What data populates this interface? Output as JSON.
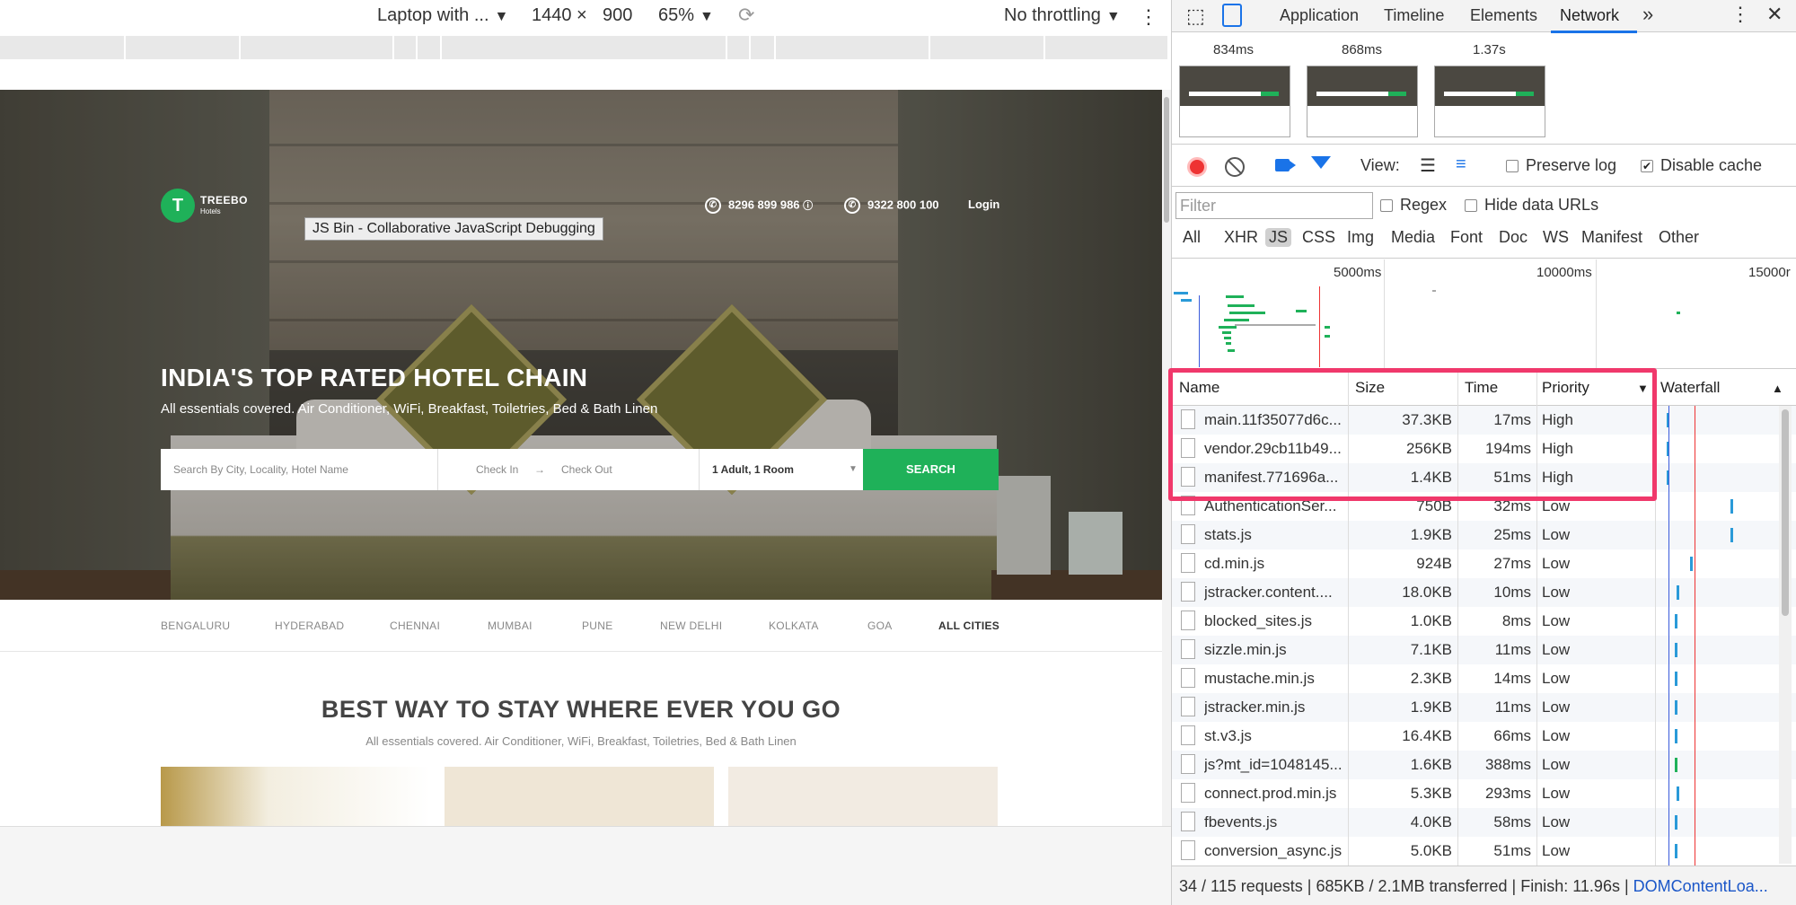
{
  "device_toolbar": {
    "device": "Laptop with ...",
    "width": "1440",
    "times": "×",
    "height": "900",
    "zoom": "65%",
    "throttling": "No throttling"
  },
  "site": {
    "brand": "TREEBO",
    "brand_sub": "Hotels",
    "tooltip": "JS Bin - Collaborative JavaScript Debugging",
    "phone1": "8296 899 986",
    "phone2": "9322 800 100",
    "login": "Login",
    "hero_title": "INDIA'S TOP RATED HOTEL CHAIN",
    "hero_sub": "All essentials covered. Air Conditioner, WiFi, Breakfast, Toiletries, Bed & Bath Linen",
    "search": {
      "placeholder": "Search By City, Locality, Hotel Name",
      "check_in": "Check In",
      "check_out": "Check Out",
      "guests": "1 Adult, 1 Room",
      "button": "SEARCH"
    },
    "cities": [
      "BENGALURU",
      "HYDERABAD",
      "CHENNAI",
      "MUMBAI",
      "PUNE",
      "NEW DELHI",
      "KOLKATA",
      "GOA",
      "ALL CITIES"
    ],
    "section_title": "BEST WAY TO STAY WHERE EVER YOU GO",
    "section_sub": "All essentials covered. Air Conditioner, WiFi, Breakfast, Toiletries, Bed & Bath Linen"
  },
  "devtools": {
    "tabs": [
      "Application",
      "Timeline",
      "Elements",
      "Network"
    ],
    "active_tab": "Network",
    "more": "»",
    "filmstrip": [
      "834ms",
      "868ms",
      "1.37s"
    ],
    "view_label": "View:",
    "preserve_log": "Preserve log",
    "disable_cache": "Disable cache",
    "filter_placeholder": "Filter",
    "regex": "Regex",
    "hide_data_urls": "Hide data URLs",
    "types": [
      "All",
      "XHR",
      "JS",
      "CSS",
      "Img",
      "Media",
      "Font",
      "Doc",
      "WS",
      "Manifest",
      "Other"
    ],
    "active_type": "JS",
    "overview_labels": [
      "5000ms",
      "10000ms",
      "15000r"
    ],
    "columns": [
      "Name",
      "Size",
      "Time",
      "Priority",
      "Waterfall"
    ],
    "sort_indicator": "▼",
    "waterfall_sort": "▲",
    "rows": [
      {
        "name": "main.11f35077d6c...",
        "size": "37.3KB",
        "time": "17ms",
        "priority": "High"
      },
      {
        "name": "vendor.29cb11b49...",
        "size": "256KB",
        "time": "194ms",
        "priority": "High"
      },
      {
        "name": "manifest.771696a...",
        "size": "1.4KB",
        "time": "51ms",
        "priority": "High"
      },
      {
        "name": "AuthenticationSer...",
        "size": "750B",
        "time": "32ms",
        "priority": "Low"
      },
      {
        "name": "stats.js",
        "size": "1.9KB",
        "time": "25ms",
        "priority": "Low"
      },
      {
        "name": "cd.min.js",
        "size": "924B",
        "time": "27ms",
        "priority": "Low"
      },
      {
        "name": "jstracker.content....",
        "size": "18.0KB",
        "time": "10ms",
        "priority": "Low"
      },
      {
        "name": "blocked_sites.js",
        "size": "1.0KB",
        "time": "8ms",
        "priority": "Low"
      },
      {
        "name": "sizzle.min.js",
        "size": "7.1KB",
        "time": "11ms",
        "priority": "Low"
      },
      {
        "name": "mustache.min.js",
        "size": "2.3KB",
        "time": "14ms",
        "priority": "Low"
      },
      {
        "name": "jstracker.min.js",
        "size": "1.9KB",
        "time": "11ms",
        "priority": "Low"
      },
      {
        "name": "st.v3.js",
        "size": "16.4KB",
        "time": "66ms",
        "priority": "Low"
      },
      {
        "name": "js?mt_id=1048145...",
        "size": "1.6KB",
        "time": "388ms",
        "priority": "Low"
      },
      {
        "name": "connect.prod.min.js",
        "size": "5.3KB",
        "time": "293ms",
        "priority": "Low"
      },
      {
        "name": "fbevents.js",
        "size": "4.0KB",
        "time": "58ms",
        "priority": "Low"
      },
      {
        "name": "conversion_async.js",
        "size": "5.0KB",
        "time": "51ms",
        "priority": "Low"
      }
    ],
    "status": "34 / 115 requests | 685KB / 2.1MB transferred | Finish: 11.96s | ",
    "status_link": "DOMContentLoa..."
  },
  "colors": {
    "accent": "#1fb159",
    "highlight": "#f0386b",
    "devtools_blue": "#1a73e8"
  }
}
